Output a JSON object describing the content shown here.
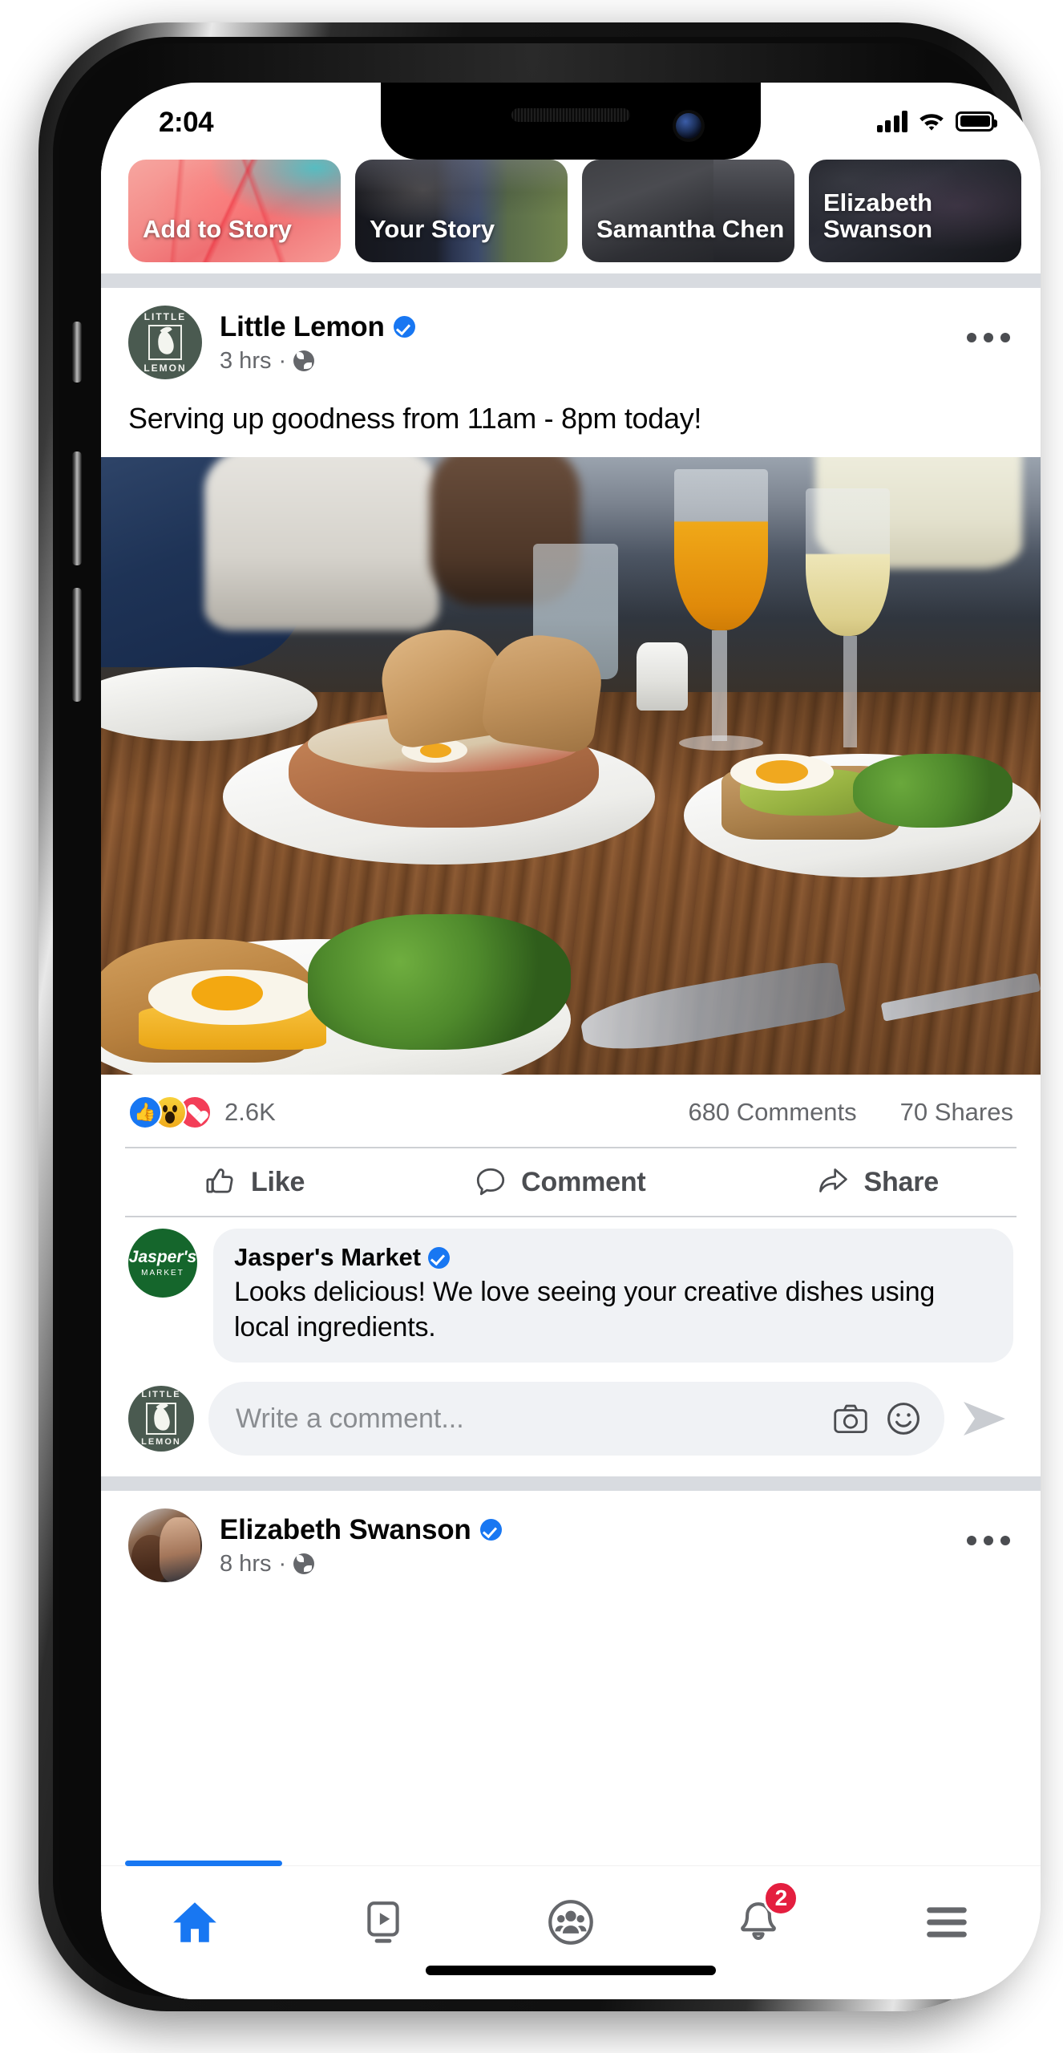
{
  "status_bar": {
    "time": "2:04",
    "signal_icon": "cellular-signal-icon",
    "wifi_icon": "wifi-icon",
    "battery_icon": "battery-icon"
  },
  "stories": {
    "items": [
      {
        "label": "Add to Story",
        "name": "story-add-to-story"
      },
      {
        "label": "Your Story",
        "name": "story-your-story"
      },
      {
        "label": "Samantha Chen",
        "name": "story-samantha-chen"
      },
      {
        "label": "Elizabeth Swanson",
        "name": "story-elizabeth-swanson"
      }
    ]
  },
  "post": {
    "author": "Little Lemon",
    "verified": true,
    "timestamp": "3 hrs",
    "separator": "·",
    "audience_icon": "globe-icon",
    "menu_icon": "more-options-icon",
    "text": "Serving up goodness from 11am - 8pm today!",
    "avatar_text_top": "LITTLE",
    "avatar_text_bottom": "LEMON",
    "engagement": {
      "reactions": [
        "like",
        "wow",
        "love"
      ],
      "reaction_count": "2.6K",
      "comments": "680 Comments",
      "shares": "70 Shares"
    },
    "actions": [
      {
        "label": "Like",
        "icon": "thumbs-up-icon"
      },
      {
        "label": "Comment",
        "icon": "comment-bubble-icon"
      },
      {
        "label": "Share",
        "icon": "share-arrow-icon"
      }
    ],
    "comment": {
      "author": "Jasper's Market",
      "verified": true,
      "body": "Looks delicious! We love seeing your creative dishes using local ingredients.",
      "avatar_text_top": "Jasper's",
      "avatar_text_bottom": "MARKET"
    },
    "composer": {
      "placeholder": "Write a comment...",
      "camera_icon": "camera-icon",
      "emoji_icon": "emoji-smiley-icon",
      "send_icon": "send-icon"
    }
  },
  "next_post": {
    "author": "Elizabeth Swanson",
    "verified": true,
    "timestamp": "8 hrs",
    "separator": "·",
    "audience_icon": "globe-icon",
    "menu_icon": "more-options-icon"
  },
  "bottom_nav": {
    "items": [
      {
        "name": "nav-home",
        "icon": "home-icon",
        "active": true
      },
      {
        "name": "nav-watch",
        "icon": "video-play-icon",
        "active": false
      },
      {
        "name": "nav-groups",
        "icon": "groups-people-icon",
        "active": false
      },
      {
        "name": "nav-notifications",
        "icon": "bell-icon",
        "active": false,
        "badge": "2"
      },
      {
        "name": "nav-menu",
        "icon": "hamburger-menu-icon",
        "active": false
      }
    ]
  },
  "colors": {
    "brand_blue": "#1877f2",
    "verified_blue": "#1877f2",
    "badge_red": "#e41e3f",
    "secondary_text": "#65676b",
    "bubble_grey": "#f0f2f5",
    "divider_grey": "#d8dbe0",
    "little_lemon_green": "#4a5a50",
    "jaspers_green": "#15662c"
  }
}
